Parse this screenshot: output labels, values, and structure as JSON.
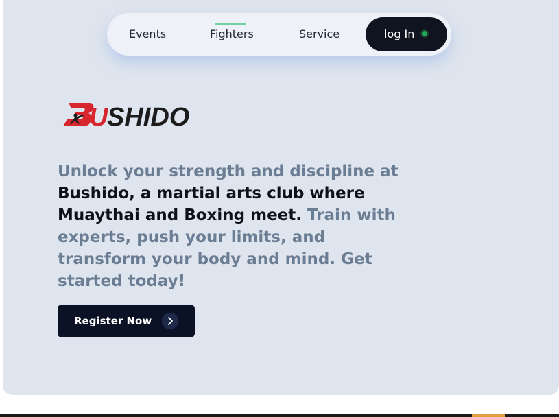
{
  "nav": {
    "items": [
      "Events",
      "Fighters",
      "Service"
    ],
    "active": "Fighters",
    "login_label": "log In",
    "status_color": "#1fa85a"
  },
  "brand": {
    "logo_text": "BUSHIDO",
    "colors": {
      "red": "#d8262e",
      "dark": "#1c1c1c"
    }
  },
  "hero": {
    "description_muted_1": "Unlock your strength and discipline at",
    "description_dark": "Bushido, a martial arts club where Muaythai and Boxing meet.",
    "description_muted_2": "Train with experts, push your limits, and transform your body and mind. Get started today!",
    "cta_label": "Register Now",
    "cta_icon": "chevron-right-icon"
  },
  "colors": {
    "background": "#dfe5ee",
    "nav_background": "#eef2f8",
    "button_dark": "#0c1226",
    "muted_text": "#6b7d93",
    "active_indicator": "#6fd3a1"
  }
}
